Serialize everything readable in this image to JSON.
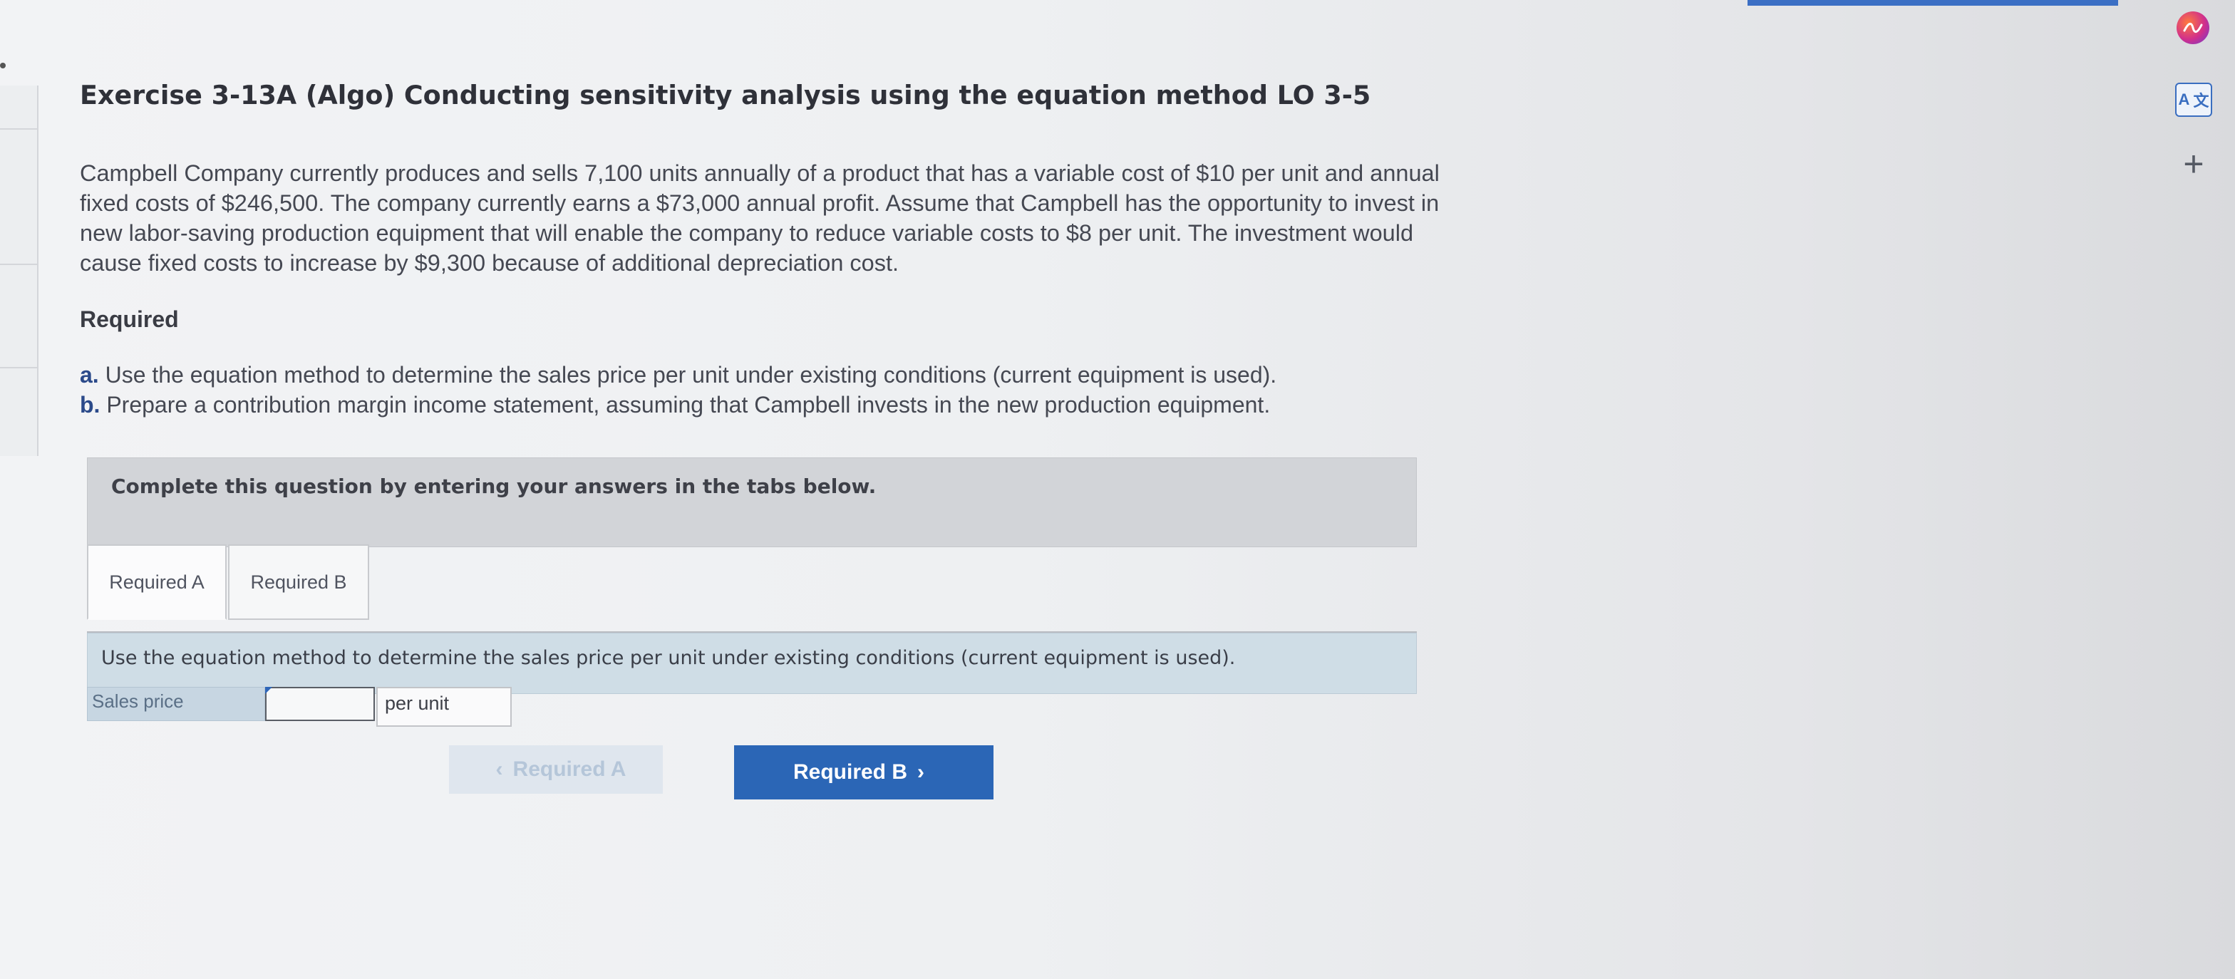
{
  "exercise": {
    "title": "Exercise 3-13A (Algo) Conducting sensitivity analysis using the equation method LO 3-5",
    "problem_lines": [
      "Campbell Company currently produces and sells 7,100 units annually of a product that has a variable cost of $10 per unit and annual",
      "fixed costs of $246,500. The company currently earns a $73,000 annual profit. Assume that Campbell has the opportunity to invest in",
      "new labor-saving production equipment that will enable the company to reduce variable costs to $8 per unit. The investment would",
      "cause fixed costs to increase by $9,300 because of additional depreciation cost."
    ],
    "required_heading": "Required",
    "required_items": [
      {
        "letter": "a.",
        "text": "Use the equation method to determine the sales price per unit under existing conditions (current equipment is used)."
      },
      {
        "letter": "b.",
        "text": "Prepare a contribution margin income statement, assuming that Campbell invests in the new production equipment."
      }
    ]
  },
  "instruction": "Complete this question by entering your answers in the tabs below.",
  "tabs": [
    {
      "label": "Required A",
      "active": true
    },
    {
      "label": "Required B",
      "active": false
    }
  ],
  "question": {
    "text": "Use the equation method to determine the sales price per unit under existing conditions (current equipment is used).",
    "field_label": "Sales price",
    "field_value": "",
    "unit_label": "per unit"
  },
  "navigation": {
    "prev_label": "Required A",
    "prev_chevron": "‹",
    "next_label": "Required B",
    "next_chevron": "›"
  },
  "side_toolbar": {
    "icons": [
      "assistant-icon",
      "translate-icon",
      "plus-icon"
    ],
    "translate_glyph_a": "A",
    "translate_glyph_b": "文",
    "plus_glyph": "+"
  },
  "colors": {
    "primary_button": "#2b66b6",
    "question_box": "#cfdde6",
    "instruction_box": "#d2d4d8"
  }
}
